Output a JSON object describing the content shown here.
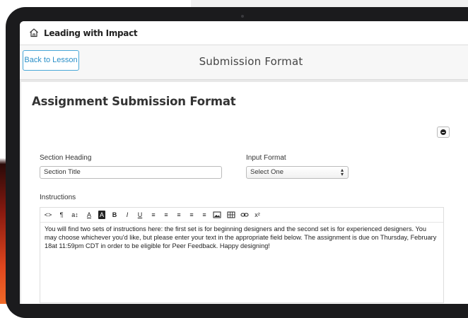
{
  "app": {
    "title": "Leading with Impact",
    "home_icon": "home-icon"
  },
  "subheader": {
    "back_label": "Back to Lesson",
    "title": "Submission Format"
  },
  "card": {
    "heading": "Assignment Submission Format",
    "remove_icon": "minus-circle-icon",
    "section_heading": {
      "label": "Section Heading",
      "value": "Section Title"
    },
    "input_format": {
      "label": "Input Format",
      "selected": "Select One"
    },
    "instructions": {
      "label": "Instructions",
      "toolbar": [
        "<>",
        "¶",
        "a↕",
        "A",
        "A",
        "B",
        "I",
        "U",
        "≡",
        "≡",
        "≡",
        "≡",
        "≡",
        "image",
        "table",
        "link",
        "x²"
      ],
      "body": "You will find two sets of instructions here: the first set is for beginning designers and the second set is for experienced designers. You may choose whichever you'd like, but please enter your text in the appropriate field below. The assignment is due on Thursday, February 18at 11:59pm CDT in order to be eligible for Peer Feedback. Happy designing!"
    }
  },
  "colors": {
    "accent": "#2a8fc8",
    "device": "#1b1b1d",
    "page_bg": "#e8e8e8"
  }
}
